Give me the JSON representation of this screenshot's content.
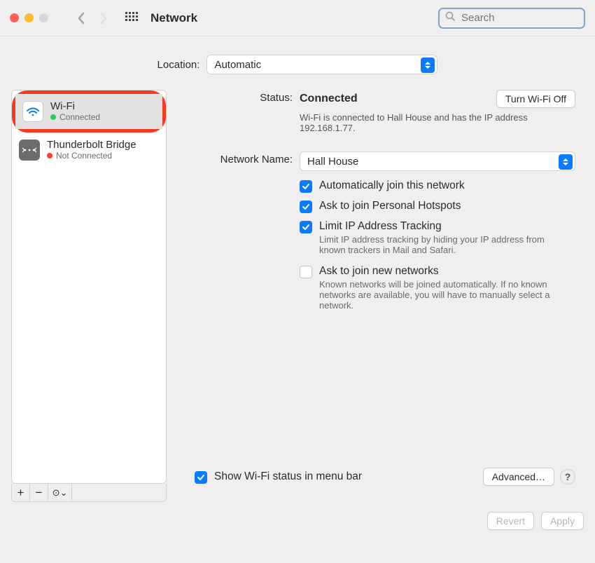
{
  "header": {
    "title": "Network",
    "search_placeholder": "Search"
  },
  "location": {
    "label": "Location:",
    "value": "Automatic"
  },
  "sidebar": {
    "items": [
      {
        "name": "Wi-Fi",
        "status": "Connected",
        "selected": true,
        "color": "green"
      },
      {
        "name": "Thunderbolt Bridge",
        "status": "Not Connected",
        "selected": false,
        "color": "red"
      }
    ],
    "foot_add": "+",
    "foot_remove": "−",
    "foot_gear": "⊙⌄"
  },
  "detail": {
    "status_label": "Status:",
    "status_value": "Connected",
    "toggle_button": "Turn Wi-Fi Off",
    "status_desc": "Wi-Fi is connected to Hall House and has the IP address 192.168.1.77.",
    "network_name_label": "Network Name:",
    "network_name_value": "Hall House",
    "checks": {
      "auto_join": "Automatically join this network",
      "ask_hotspots": "Ask to join Personal Hotspots",
      "limit_ip": "Limit IP Address Tracking",
      "limit_ip_desc": "Limit IP address tracking by hiding your IP address from known trackers in Mail and Safari.",
      "ask_new": "Ask to join new networks",
      "ask_new_desc": "Known networks will be joined automatically. If no known networks are available, you will have to manually select a network."
    },
    "menubar_check": "Show Wi-Fi status in menu bar",
    "advanced_button": "Advanced…",
    "help": "?"
  },
  "bottom": {
    "revert": "Revert",
    "apply": "Apply"
  }
}
